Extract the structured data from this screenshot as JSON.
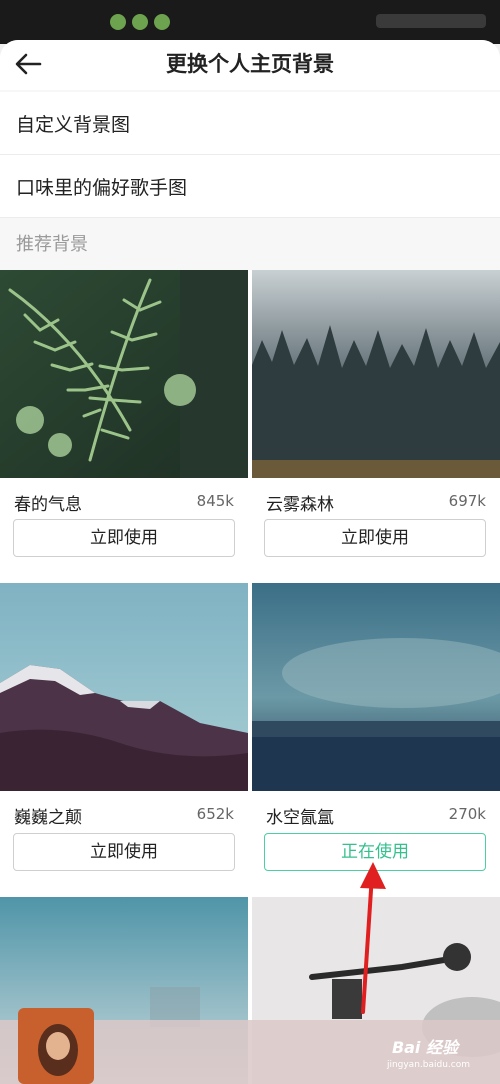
{
  "header": {
    "title": "更换个人主页背景"
  },
  "options": {
    "custom": "自定义背景图",
    "singer": "口味里的偏好歌手图"
  },
  "section": {
    "recommended": "推荐背景"
  },
  "cards": [
    {
      "name": "春的气息",
      "count": "845k",
      "button": "立即使用"
    },
    {
      "name": "云雾森林",
      "count": "697k",
      "button": "立即使用"
    },
    {
      "name": "巍巍之颠",
      "count": "652k",
      "button": "立即使用"
    },
    {
      "name": "水空氤氲",
      "count": "270k",
      "button": "正在使用"
    }
  ],
  "player": {
    "text": ""
  },
  "watermark": {
    "brand": "Bai 经验",
    "site": "jingyan.baidu.com"
  },
  "colors": {
    "active": "#36c08d",
    "arrow": "#e02020"
  }
}
